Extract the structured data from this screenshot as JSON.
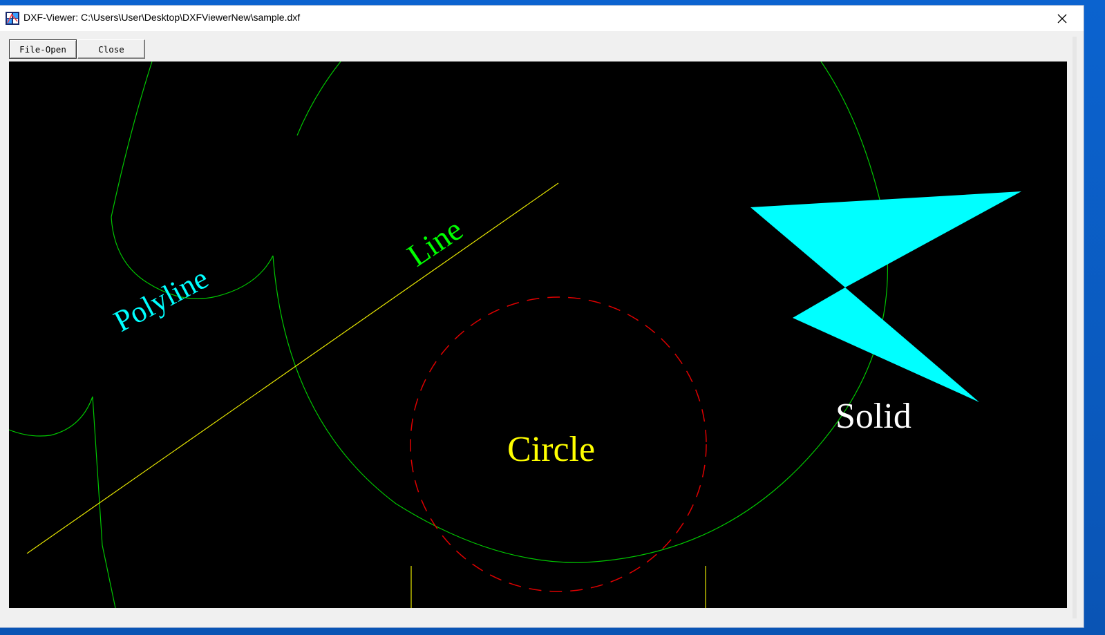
{
  "window": {
    "title": "DXF-Viewer: C:\\Users\\User\\Desktop\\DXFViewerNew\\sample.dxf",
    "app_icon": "dxf-viewer-app-icon",
    "close_icon": "close-icon"
  },
  "toolbar": {
    "open_label": "File-Open",
    "close_label": "Close"
  },
  "drawing": {
    "background": "#000000",
    "labels": {
      "polyline": "Polyline",
      "line": "Line",
      "circle": "Circle",
      "solid": "Solid"
    },
    "colors": {
      "green": "#00c800",
      "yellow": "#e6e600",
      "red": "#e00000",
      "cyan": "#00ffff",
      "white": "#ffffff"
    }
  }
}
